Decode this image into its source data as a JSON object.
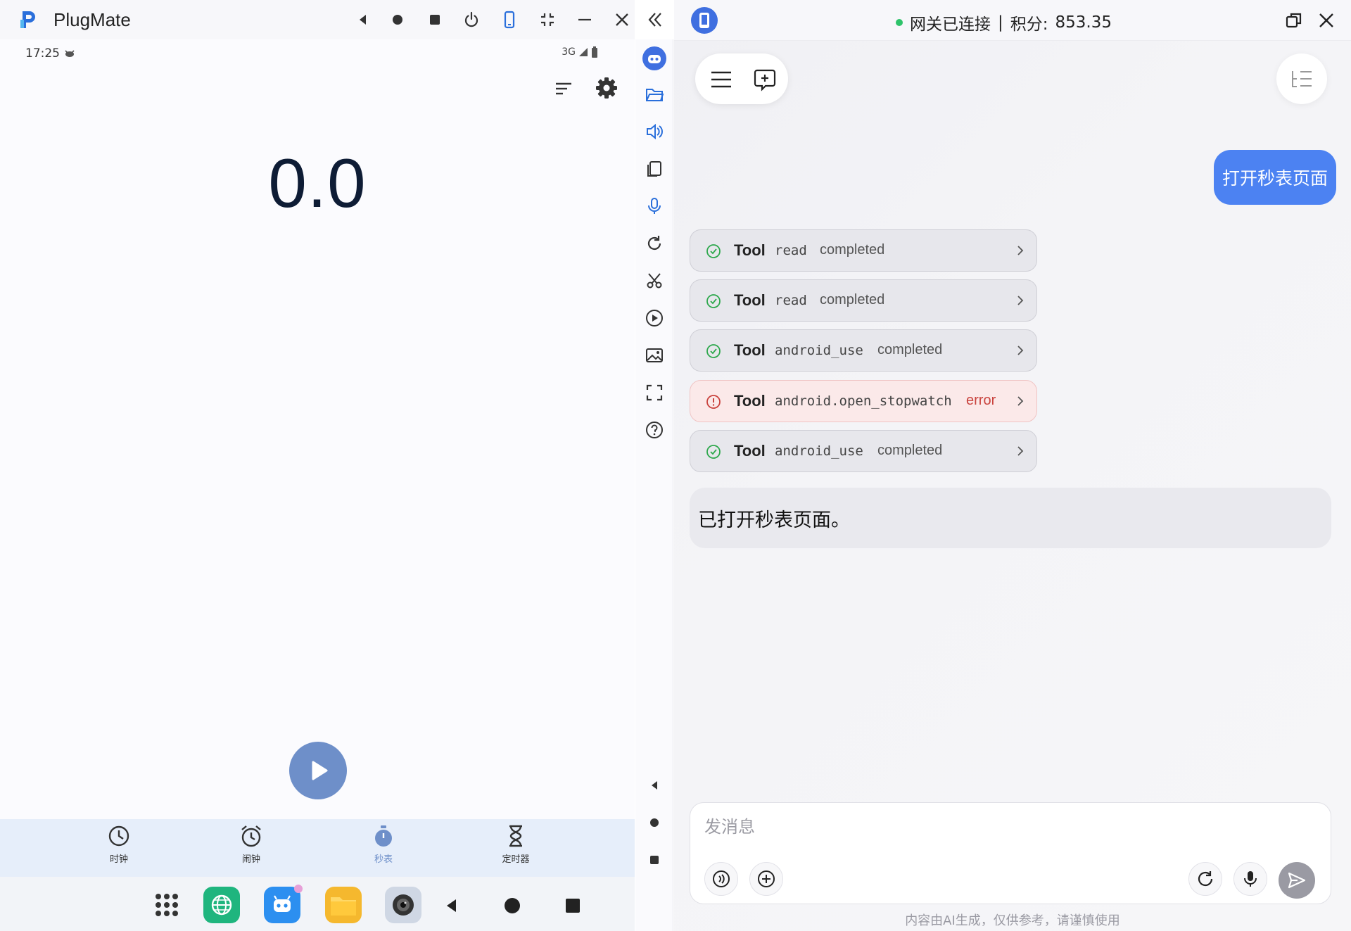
{
  "window": {
    "title": "PlugMate"
  },
  "phone": {
    "status_time": "17:25",
    "status_network": "3G",
    "timer": "0.0",
    "clock_tabs": [
      {
        "label": "时钟",
        "icon": "clock-icon",
        "active": false
      },
      {
        "label": "闹钟",
        "icon": "alarm-icon",
        "active": false
      },
      {
        "label": "秒表",
        "icon": "stopwatch-icon",
        "active": true
      },
      {
        "label": "定时器",
        "icon": "hourglass-icon",
        "active": false
      }
    ],
    "dock_apps": [
      "app-drawer-icon",
      "browser-icon",
      "robot-app-icon",
      "files-icon",
      "camera-icon"
    ]
  },
  "chat": {
    "gateway_status": "网关已连接",
    "separator": "|",
    "points_label": "积分:",
    "points_value": "853.35",
    "user_message": "打开秒表页面",
    "tool_calls": [
      {
        "label": "Tool",
        "name": "read",
        "status": "completed",
        "state": "success"
      },
      {
        "label": "Tool",
        "name": "read",
        "status": "completed",
        "state": "success"
      },
      {
        "label": "Tool",
        "name": "android_use",
        "status": "completed",
        "state": "success"
      },
      {
        "label": "Tool",
        "name": "android.open_stopwatch",
        "status": "error",
        "state": "error"
      },
      {
        "label": "Tool",
        "name": "android_use",
        "status": "completed",
        "state": "success"
      }
    ],
    "assistant_message": "已打开秒表页面。",
    "composer": {
      "placeholder": "发消息"
    },
    "disclaimer": "内容由AI生成，仅供参考，请谨慎使用"
  },
  "colors": {
    "accent": "#4c82f2",
    "success": "#2ea84d",
    "error": "#c9423d",
    "play_button": "#6e8fc9",
    "timer_text": "#0e1c35"
  }
}
